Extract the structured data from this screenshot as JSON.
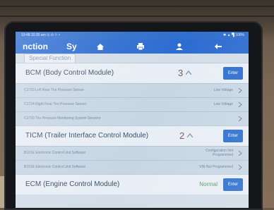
{
  "statusbar": {
    "left_text": "10:48  10:35 am  ⊙ ⊙ ⚐ •",
    "right_text": "✱ ▲ ▜ 100%"
  },
  "tabbar": {
    "title": "nction",
    "second_title": "Sy",
    "icons": [
      "home-icon",
      "printer-icon",
      "person-icon",
      "back-arrow-icon"
    ]
  },
  "breadcrumb": "Special Function",
  "modules": [
    {
      "name": "BCM (Body Control Module)",
      "count": "3",
      "button": "Enter",
      "dtcs": [
        {
          "description": "C1723 Left Rear Tire Pressure Sensor",
          "status": "Low Voltage"
        },
        {
          "description": "C1724 Right Rear Tire Pressure Sensor",
          "status": "Low Voltage"
        },
        {
          "description": "C1733 Tire Pressure Monitoring System Sensors",
          "status": ""
        }
      ]
    },
    {
      "name": "TICM (Trailer Interface Control Module)",
      "count": "2",
      "button": "Enter",
      "dtcs": [
        {
          "description": "B101E Electronic Control Unit Software",
          "status_line1": "Configuration Not",
          "status_line2": "Programmed"
        },
        {
          "description": "B101E Electronic Control Unit Software",
          "status": "VIN Not Programmed"
        }
      ]
    },
    {
      "name": "ECM (Engine Control Module)",
      "status": "Normal",
      "button": "Enter"
    }
  ],
  "colors": {
    "accent": "#2f6fce",
    "module_row_bg": "#e8eef5",
    "dtc_row_bg": "#c8d6e4",
    "normal_green": "#5b9a6b"
  }
}
